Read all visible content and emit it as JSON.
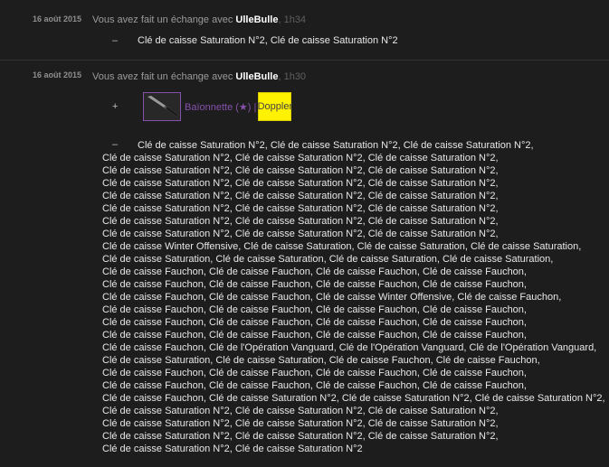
{
  "trade1": {
    "date": "16 août 2015",
    "desc_prefix": "Vous avez fait un échange avec ",
    "user": "UlleBulle",
    "time": ", 1h34",
    "sign": "–",
    "given_items": "Clé de caisse Saturation N°2, Clé de caisse Saturation N°2"
  },
  "trade2": {
    "date": "16 août 2015",
    "desc_prefix": "Vous avez fait un échange avec ",
    "user": "UlleBulle",
    "time": ", 1h30",
    "received_sign": "+",
    "received_item": {
      "name": "Baïonnette (★) | ",
      "tag": "Doppler",
      "icon": "bayonet-knife-icon",
      "rarity_color": "#8650ac",
      "tag_color": "#fff200"
    },
    "given_sign": "–",
    "given_lines": [
      "Clé de caisse Saturation N°2, Clé de caisse Saturation N°2, Clé de caisse Saturation N°2,",
      "Clé de caisse Saturation N°2, Clé de caisse Saturation N°2, Clé de caisse Saturation N°2,",
      "Clé de caisse Saturation N°2, Clé de caisse Saturation N°2, Clé de caisse Saturation N°2,",
      "Clé de caisse Saturation N°2, Clé de caisse Saturation N°2, Clé de caisse Saturation N°2,",
      "Clé de caisse Saturation N°2, Clé de caisse Saturation N°2, Clé de caisse Saturation N°2,",
      "Clé de caisse Saturation N°2, Clé de caisse Saturation N°2, Clé de caisse Saturation N°2,",
      "Clé de caisse Saturation N°2, Clé de caisse Saturation N°2, Clé de caisse Saturation N°2,",
      "Clé de caisse Saturation N°2, Clé de caisse Saturation N°2, Clé de caisse Saturation N°2,",
      "Clé de caisse Winter Offensive, Clé de caisse Saturation, Clé de caisse Saturation, Clé de caisse Saturation,",
      "Clé de caisse Saturation, Clé de caisse Saturation, Clé de caisse Saturation, Clé de caisse Saturation,",
      "Clé de caisse Fauchon, Clé de caisse Fauchon, Clé de caisse Fauchon, Clé de caisse Fauchon,",
      "Clé de caisse Fauchon, Clé de caisse Fauchon, Clé de caisse Fauchon, Clé de caisse Fauchon,",
      "Clé de caisse Fauchon, Clé de caisse Fauchon, Clé de caisse Winter Offensive, Clé de caisse Fauchon,",
      "Clé de caisse Fauchon, Clé de caisse Fauchon, Clé de caisse Fauchon, Clé de caisse Fauchon,",
      "Clé de caisse Fauchon, Clé de caisse Fauchon, Clé de caisse Fauchon, Clé de caisse Fauchon,",
      "Clé de caisse Fauchon, Clé de caisse Fauchon, Clé de caisse Fauchon, Clé de caisse Fauchon,",
      "Clé de caisse Fauchon, Clé de l'Opération Vanguard, Clé de l'Opération Vanguard, Clé de l'Opération Vanguard,",
      "Clé de caisse Saturation, Clé de caisse Saturation, Clé de caisse Fauchon, Clé de caisse Fauchon,",
      "Clé de caisse Fauchon, Clé de caisse Fauchon, Clé de caisse Fauchon, Clé de caisse Fauchon,",
      "Clé de caisse Fauchon, Clé de caisse Fauchon, Clé de caisse Fauchon, Clé de caisse Fauchon,",
      "Clé de caisse Fauchon, Clé de caisse Saturation N°2, Clé de caisse Saturation N°2, Clé de caisse Saturation N°2,",
      "Clé de caisse Saturation N°2, Clé de caisse Saturation N°2, Clé de caisse Saturation N°2,",
      "Clé de caisse Saturation N°2, Clé de caisse Saturation N°2, Clé de caisse Saturation N°2,",
      "Clé de caisse Saturation N°2, Clé de caisse Saturation N°2, Clé de caisse Saturation N°2,",
      "Clé de caisse Saturation N°2, Clé de caisse Saturation N°2"
    ]
  }
}
